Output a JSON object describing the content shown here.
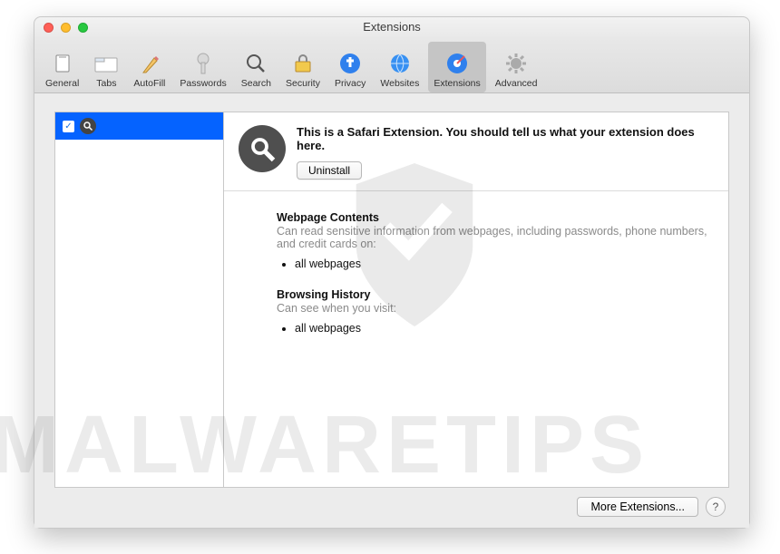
{
  "window": {
    "title": "Extensions"
  },
  "toolbar": {
    "items": [
      {
        "label": "General"
      },
      {
        "label": "Tabs"
      },
      {
        "label": "AutoFill"
      },
      {
        "label": "Passwords"
      },
      {
        "label": "Search"
      },
      {
        "label": "Security"
      },
      {
        "label": "Privacy"
      },
      {
        "label": "Websites"
      },
      {
        "label": "Extensions"
      },
      {
        "label": "Advanced"
      }
    ],
    "selected_index": 8
  },
  "sidebar": {
    "extension_checked": true
  },
  "detail": {
    "description": "This is a Safari Extension. You should tell us what your extension does here.",
    "uninstall_label": "Uninstall"
  },
  "permissions": {
    "section1_title": "Webpage Contents",
    "section1_sub": "Can read sensitive information from webpages, including passwords, phone numbers, and credit cards on:",
    "section1_items": [
      "all webpages"
    ],
    "section2_title": "Browsing History",
    "section2_sub": "Can see when you visit:",
    "section2_items": [
      "all webpages"
    ]
  },
  "footer": {
    "more_label": "More Extensions...",
    "help_label": "?"
  },
  "watermark": "MALWARETIPS"
}
